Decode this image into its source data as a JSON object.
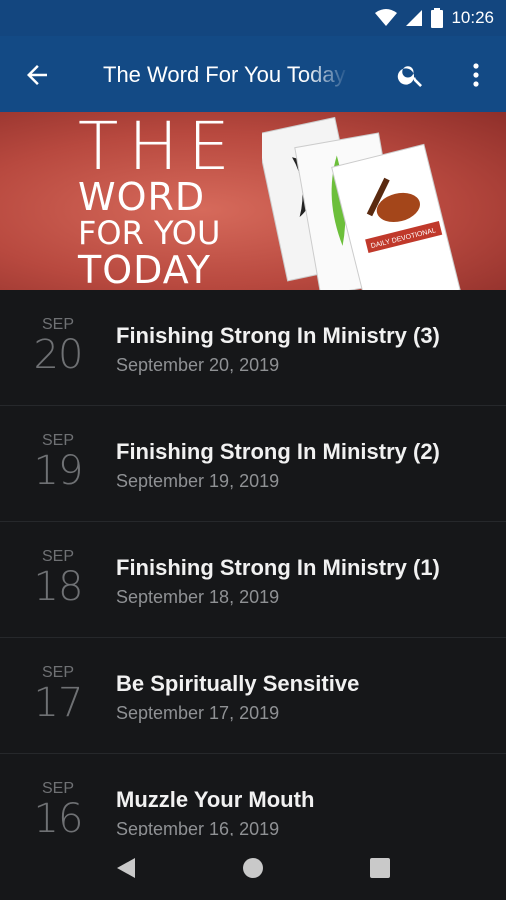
{
  "status_bar": {
    "time": "10:26",
    "icons": [
      "wifi-icon",
      "signal-icon",
      "battery-icon"
    ]
  },
  "app_bar": {
    "title": "The Word For You Today",
    "back_icon": "back-arrow-icon",
    "search_icon": "search-icon",
    "more_icon": "more-vert-icon"
  },
  "banner": {
    "line1": "THE",
    "line2": "WORD",
    "line3": "FOR YOU",
    "line4": "TODAY",
    "card_text": "DAILY DEVOTIONAL"
  },
  "list": {
    "items": [
      {
        "month": "SEP",
        "day": "20",
        "title": "Finishing Strong In Ministry (3)",
        "date": "September 20, 2019"
      },
      {
        "month": "SEP",
        "day": "19",
        "title": "Finishing Strong In Ministry (2)",
        "date": "September 19, 2019"
      },
      {
        "month": "SEP",
        "day": "18",
        "title": "Finishing Strong In Ministry (1)",
        "date": "September 18, 2019"
      },
      {
        "month": "SEP",
        "day": "17",
        "title": "Be Spiritually Sensitive",
        "date": "September 17, 2019"
      },
      {
        "month": "SEP",
        "day": "16",
        "title": "Muzzle Your Mouth",
        "date": "September 16, 2019"
      }
    ]
  },
  "colors": {
    "app_bar": "#134a85",
    "status_bar": "#13467f",
    "background": "#161719",
    "banner_red": "#b8493f"
  },
  "nav_bar": {
    "icons": [
      "back-triangle-icon",
      "home-circle-icon",
      "recents-square-icon"
    ]
  }
}
